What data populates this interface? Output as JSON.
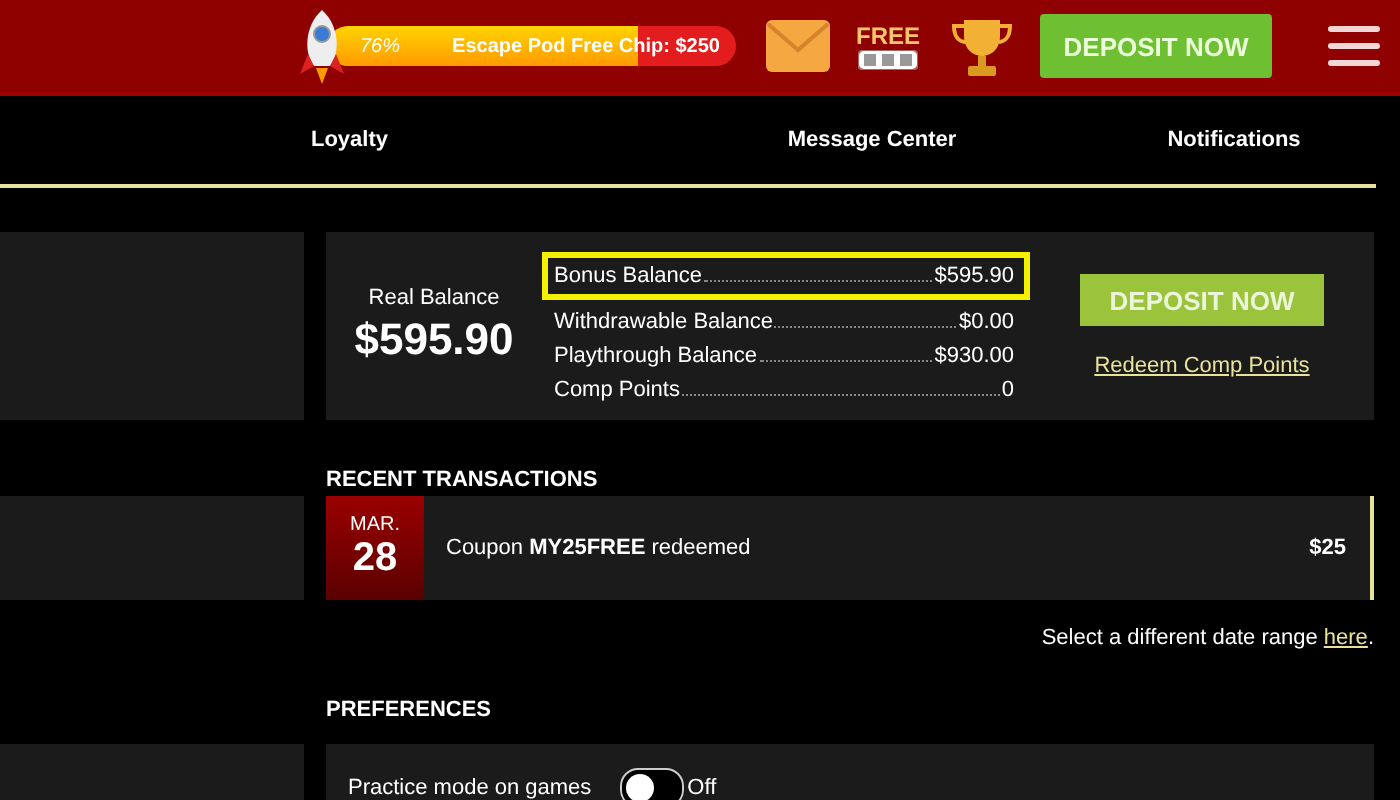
{
  "header": {
    "progress": {
      "level": 0.76,
      "percent": "76%",
      "label": "Escape Pod Free Chip: $250"
    },
    "deposit_button": "DEPOSIT NOW",
    "free_badge": "FREE"
  },
  "nav": {
    "tabs": [
      {
        "label": "Loyalty",
        "selected": false
      },
      {
        "label": "Message Center",
        "selected": false
      },
      {
        "label": "Notifications",
        "selected": false
      }
    ]
  },
  "balance": {
    "real_label": "Real Balance",
    "real_value": "$595.90",
    "rows": [
      {
        "label": "Bonus Balance",
        "value": "$595.90",
        "highlighted": true
      },
      {
        "label": "Withdrawable Balance",
        "value": "$0.00",
        "highlighted": false
      },
      {
        "label": "Playthrough Balance",
        "value": "$930.00",
        "highlighted": false
      },
      {
        "label": "Comp Points",
        "value": "0",
        "highlighted": false
      }
    ],
    "deposit_button": "DEPOSIT NOW",
    "redeem_link": "Redeem Comp Points"
  },
  "transactions": {
    "title": "RECENT TRANSACTIONS",
    "items": [
      {
        "month": "MAR.",
        "day": "28",
        "text": "Coupon **MY25FREE** redeemed",
        "amount": "$25"
      }
    ],
    "date_range_text": "Select a different date range",
    "date_range_link": "here",
    "date_range_end": "."
  },
  "preferences": {
    "title": "PREFERENCES",
    "items": [
      {
        "label": "Practice mode on games",
        "on": false,
        "state_label": "Off"
      }
    ]
  }
}
